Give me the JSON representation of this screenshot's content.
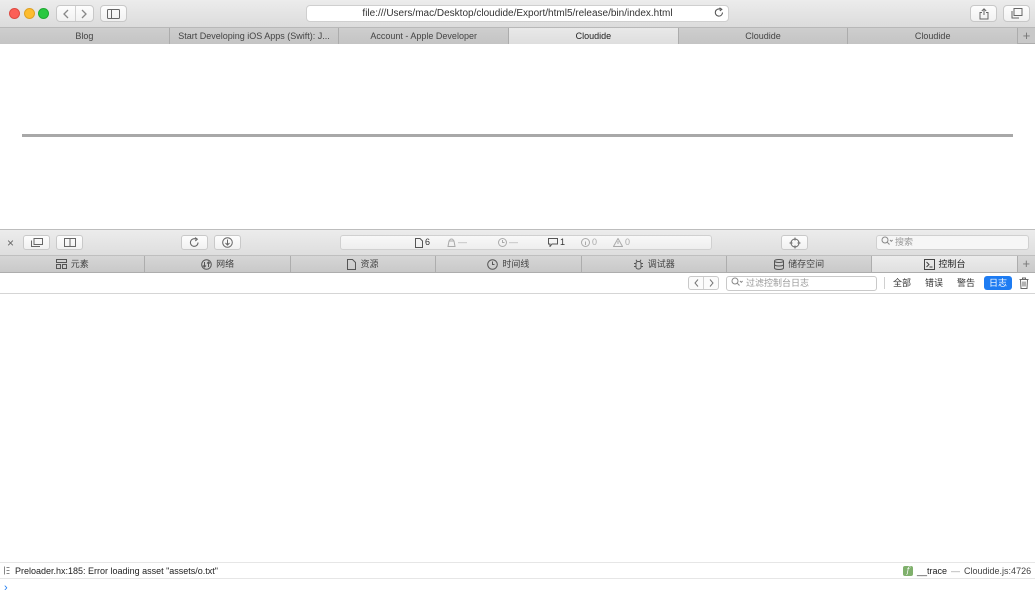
{
  "window": {
    "address_url": "file:///Users/mac/Desktop/cloudide/Export/html5/release/bin/index.html"
  },
  "tabs": [
    {
      "label": "Blog",
      "active": false
    },
    {
      "label": "Start Developing iOS Apps (Swift): J...",
      "active": false
    },
    {
      "label": "Account - Apple Developer",
      "active": false
    },
    {
      "label": "Cloudide",
      "active": true
    },
    {
      "label": "Cloudide",
      "active": false
    },
    {
      "label": "Cloudide",
      "active": false
    }
  ],
  "tab_add_label": "+",
  "page": {
    "progress_fraction": 1.0
  },
  "inspector_toolbar": {
    "close_label": "×",
    "resources_count": "6",
    "errors_count": "—",
    "time_value": "—",
    "logs_count": "1",
    "info_count": "0",
    "warnings_count": "0",
    "search_placeholder": "搜索"
  },
  "inspector_tabs": [
    {
      "label": "元素",
      "icon": "elements-icon",
      "active": false
    },
    {
      "label": "网络",
      "icon": "network-icon",
      "active": false
    },
    {
      "label": "资源",
      "icon": "resources-icon",
      "active": false
    },
    {
      "label": "时间线",
      "icon": "timeline-icon",
      "active": false
    },
    {
      "label": "调试器",
      "icon": "debugger-icon",
      "active": false
    },
    {
      "label": "储存空间",
      "icon": "storage-icon",
      "active": false
    },
    {
      "label": "控制台",
      "icon": "console-icon",
      "active": true
    }
  ],
  "console_filter": {
    "search_placeholder": "过滤控制台日志",
    "filters": [
      {
        "label": "全部",
        "active": false
      },
      {
        "label": "错误",
        "active": false
      },
      {
        "label": "警告",
        "active": false
      },
      {
        "label": "日志",
        "active": true
      }
    ]
  },
  "console_message": {
    "text": "Preloader.hx:185: Error loading asset \"assets/o.txt\"",
    "badge": "f",
    "function_name": "__trace",
    "separator": "—",
    "source": "Cloudide.js:4726"
  },
  "prompt": {
    "caret": "›"
  },
  "colors": {
    "accent": "#1e7cf2",
    "traffic_red": "#fc5f57",
    "traffic_yellow": "#fdbc2e",
    "traffic_green": "#29c841",
    "trace_badge": "#7fb06c"
  }
}
